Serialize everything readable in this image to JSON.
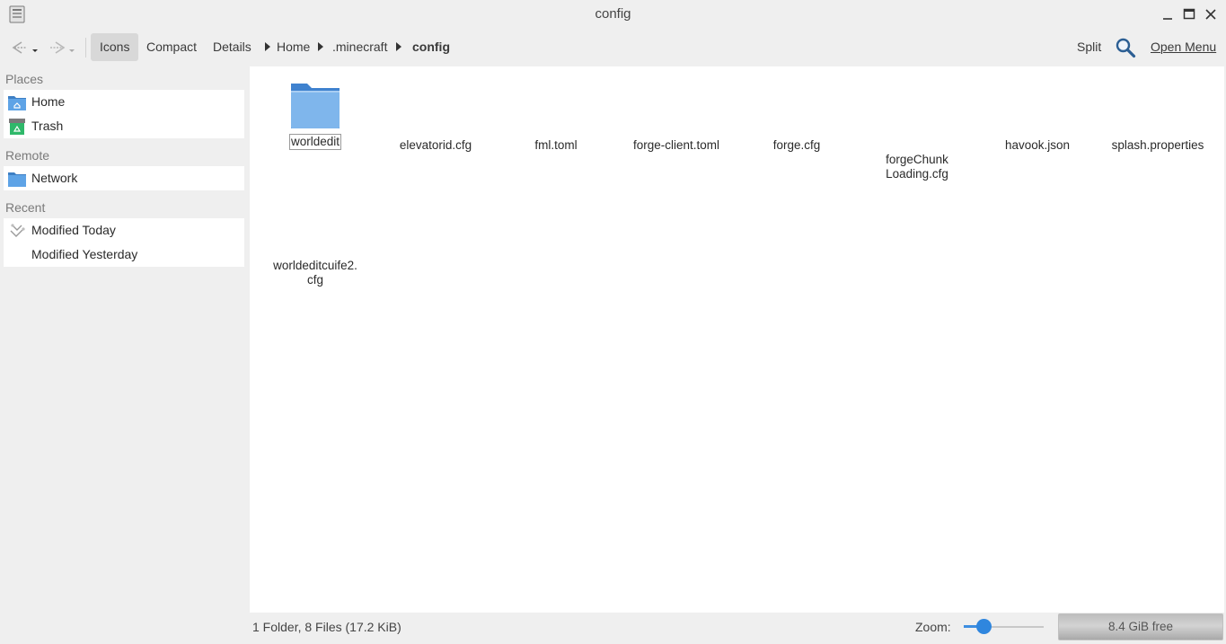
{
  "window": {
    "title": "config"
  },
  "toolbar": {
    "views": [
      {
        "label": "Icons",
        "active": true
      },
      {
        "label": "Compact",
        "active": false
      },
      {
        "label": "Details",
        "active": false
      }
    ],
    "breadcrumb": [
      "Home",
      ".minecraft",
      "config"
    ],
    "split_label": "Split",
    "open_menu_label": "Open Menu"
  },
  "sidebar": {
    "sections": [
      {
        "title": "Places",
        "items": [
          {
            "label": "Home",
            "icon": "home-folder-icon"
          },
          {
            "label": "Trash",
            "icon": "trash-icon"
          }
        ]
      },
      {
        "title": "Remote",
        "items": [
          {
            "label": "Network",
            "icon": "network-folder-icon"
          }
        ]
      },
      {
        "title": "Recent",
        "items": [
          {
            "label": "Modified Today",
            "icon": "recent-icon"
          },
          {
            "label": "Modified Yesterday",
            "icon": ""
          }
        ]
      }
    ]
  },
  "files": [
    {
      "name": "worldedit",
      "type": "folder",
      "focused": true
    },
    {
      "name": "elevatorid.cfg",
      "type": "file"
    },
    {
      "name": "fml.toml",
      "type": "file"
    },
    {
      "name": "forge-client.toml",
      "type": "file"
    },
    {
      "name": "forge.cfg",
      "type": "file"
    },
    {
      "name": "forgeChunk\nLoading.cfg",
      "type": "file"
    },
    {
      "name": "havook.json",
      "type": "file"
    },
    {
      "name": "splash.properties",
      "type": "file"
    },
    {
      "name": "worldeditcuife2.\ncfg",
      "type": "file"
    }
  ],
  "status": {
    "summary": "1 Folder, 8 Files (17.2 KiB)",
    "zoom_label": "Zoom:",
    "zoom_level": 0.25,
    "free_space": "8.4 GiB free",
    "disk_used_fraction": 0.0
  },
  "colors": {
    "accent": "#2f86de",
    "folder": "#4a90d9"
  }
}
